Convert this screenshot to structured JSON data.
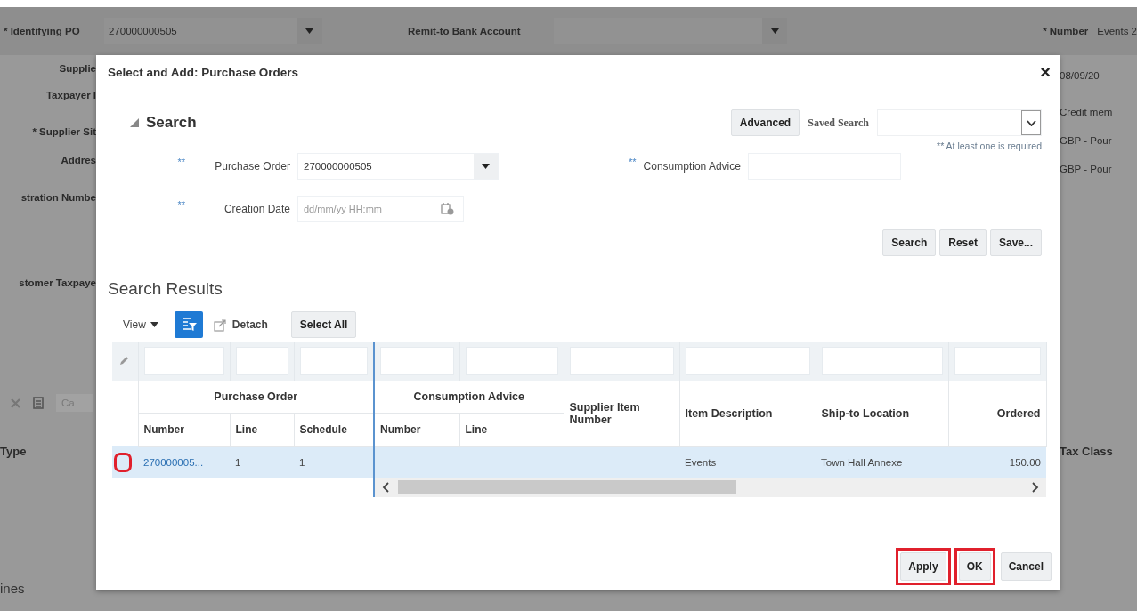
{
  "page": {
    "identifying_po": {
      "required_mark": "*",
      "label": "Identifying PO",
      "value": "270000000505"
    },
    "remit_to": {
      "label": "Remit-to Bank Account"
    },
    "number": {
      "required_mark": "*",
      "label": "Number",
      "value": "Events 2"
    },
    "left_labels": [
      {
        "label": "Supplie"
      },
      {
        "label": "Taxpayer I"
      },
      {
        "required_mark": "*",
        "label": "Supplier Sit"
      },
      {
        "label": "Addres"
      },
      {
        "label": "stration Numbe"
      },
      {
        "label": "stomer Taxpaye"
      }
    ],
    "toolbar_field": "Ca",
    "type_header": "Type",
    "lines_heading": "ines",
    "right_values": [
      "08/09/20",
      "Credit mem",
      "GBP - Pour",
      "GBP - Pour"
    ],
    "tax_header": "Tax Class"
  },
  "dialog": {
    "title": "Select and Add: Purchase Orders",
    "close": "×",
    "search": {
      "heading": "Search",
      "expanded": true,
      "advanced_button": "Advanced",
      "saved_search_label": "Saved Search",
      "required_note": "** At least one is required",
      "left_fields": [
        {
          "required_mark": "**",
          "label": "Purchase Order",
          "value": "270000000505",
          "kind": "dropdown"
        },
        {
          "required_mark": "**",
          "label": "Creation Date",
          "placeholder": "dd/mm/yy HH:mm",
          "kind": "date"
        }
      ],
      "right_fields": [
        {
          "required_mark": "**",
          "label": "Consumption Advice",
          "kind": "text"
        }
      ],
      "buttons": [
        "Search",
        "Reset",
        "Save..."
      ]
    },
    "results": {
      "heading": "Search Results",
      "view_menu": "View",
      "detach": "Detach",
      "select_all": "Select All",
      "header": [
        {
          "label": "Purchase Order",
          "children": [
            "Number",
            "Line",
            "Schedule"
          ]
        },
        {
          "label": "Consumption Advice",
          "children": [
            "Number",
            "Line"
          ]
        },
        {
          "label": "Supplier Item Number"
        },
        {
          "label": "Item Description"
        },
        {
          "label": "Ship-to Location"
        },
        {
          "label": "Ordered"
        }
      ],
      "rows": [
        {
          "selected": true,
          "highlighted": true,
          "cells": [
            "270000005...",
            "1",
            "1",
            null,
            null,
            null,
            "Events",
            "Town Hall Annexe",
            "150.00"
          ]
        }
      ]
    },
    "buttons": [
      {
        "label": "Apply",
        "highlighted": true
      },
      {
        "label": "OK",
        "highlighted": true
      },
      {
        "label": "Cancel",
        "highlighted": false
      }
    ]
  }
}
